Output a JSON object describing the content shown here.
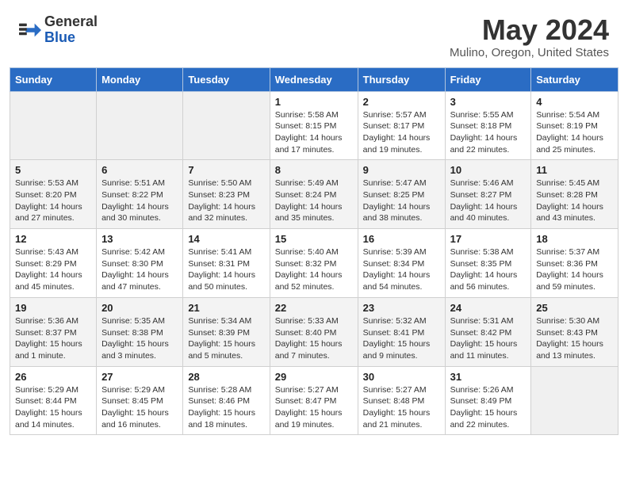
{
  "header": {
    "logo_general": "General",
    "logo_blue": "Blue",
    "month_year": "May 2024",
    "location": "Mulino, Oregon, United States"
  },
  "days_of_week": [
    "Sunday",
    "Monday",
    "Tuesday",
    "Wednesday",
    "Thursday",
    "Friday",
    "Saturday"
  ],
  "weeks": [
    [
      {
        "day": "",
        "info": ""
      },
      {
        "day": "",
        "info": ""
      },
      {
        "day": "",
        "info": ""
      },
      {
        "day": "1",
        "info": "Sunrise: 5:58 AM\nSunset: 8:15 PM\nDaylight: 14 hours and 17 minutes."
      },
      {
        "day": "2",
        "info": "Sunrise: 5:57 AM\nSunset: 8:17 PM\nDaylight: 14 hours and 19 minutes."
      },
      {
        "day": "3",
        "info": "Sunrise: 5:55 AM\nSunset: 8:18 PM\nDaylight: 14 hours and 22 minutes."
      },
      {
        "day": "4",
        "info": "Sunrise: 5:54 AM\nSunset: 8:19 PM\nDaylight: 14 hours and 25 minutes."
      }
    ],
    [
      {
        "day": "5",
        "info": "Sunrise: 5:53 AM\nSunset: 8:20 PM\nDaylight: 14 hours and 27 minutes."
      },
      {
        "day": "6",
        "info": "Sunrise: 5:51 AM\nSunset: 8:22 PM\nDaylight: 14 hours and 30 minutes."
      },
      {
        "day": "7",
        "info": "Sunrise: 5:50 AM\nSunset: 8:23 PM\nDaylight: 14 hours and 32 minutes."
      },
      {
        "day": "8",
        "info": "Sunrise: 5:49 AM\nSunset: 8:24 PM\nDaylight: 14 hours and 35 minutes."
      },
      {
        "day": "9",
        "info": "Sunrise: 5:47 AM\nSunset: 8:25 PM\nDaylight: 14 hours and 38 minutes."
      },
      {
        "day": "10",
        "info": "Sunrise: 5:46 AM\nSunset: 8:27 PM\nDaylight: 14 hours and 40 minutes."
      },
      {
        "day": "11",
        "info": "Sunrise: 5:45 AM\nSunset: 8:28 PM\nDaylight: 14 hours and 43 minutes."
      }
    ],
    [
      {
        "day": "12",
        "info": "Sunrise: 5:43 AM\nSunset: 8:29 PM\nDaylight: 14 hours and 45 minutes."
      },
      {
        "day": "13",
        "info": "Sunrise: 5:42 AM\nSunset: 8:30 PM\nDaylight: 14 hours and 47 minutes."
      },
      {
        "day": "14",
        "info": "Sunrise: 5:41 AM\nSunset: 8:31 PM\nDaylight: 14 hours and 50 minutes."
      },
      {
        "day": "15",
        "info": "Sunrise: 5:40 AM\nSunset: 8:32 PM\nDaylight: 14 hours and 52 minutes."
      },
      {
        "day": "16",
        "info": "Sunrise: 5:39 AM\nSunset: 8:34 PM\nDaylight: 14 hours and 54 minutes."
      },
      {
        "day": "17",
        "info": "Sunrise: 5:38 AM\nSunset: 8:35 PM\nDaylight: 14 hours and 56 minutes."
      },
      {
        "day": "18",
        "info": "Sunrise: 5:37 AM\nSunset: 8:36 PM\nDaylight: 14 hours and 59 minutes."
      }
    ],
    [
      {
        "day": "19",
        "info": "Sunrise: 5:36 AM\nSunset: 8:37 PM\nDaylight: 15 hours and 1 minute."
      },
      {
        "day": "20",
        "info": "Sunrise: 5:35 AM\nSunset: 8:38 PM\nDaylight: 15 hours and 3 minutes."
      },
      {
        "day": "21",
        "info": "Sunrise: 5:34 AM\nSunset: 8:39 PM\nDaylight: 15 hours and 5 minutes."
      },
      {
        "day": "22",
        "info": "Sunrise: 5:33 AM\nSunset: 8:40 PM\nDaylight: 15 hours and 7 minutes."
      },
      {
        "day": "23",
        "info": "Sunrise: 5:32 AM\nSunset: 8:41 PM\nDaylight: 15 hours and 9 minutes."
      },
      {
        "day": "24",
        "info": "Sunrise: 5:31 AM\nSunset: 8:42 PM\nDaylight: 15 hours and 11 minutes."
      },
      {
        "day": "25",
        "info": "Sunrise: 5:30 AM\nSunset: 8:43 PM\nDaylight: 15 hours and 13 minutes."
      }
    ],
    [
      {
        "day": "26",
        "info": "Sunrise: 5:29 AM\nSunset: 8:44 PM\nDaylight: 15 hours and 14 minutes."
      },
      {
        "day": "27",
        "info": "Sunrise: 5:29 AM\nSunset: 8:45 PM\nDaylight: 15 hours and 16 minutes."
      },
      {
        "day": "28",
        "info": "Sunrise: 5:28 AM\nSunset: 8:46 PM\nDaylight: 15 hours and 18 minutes."
      },
      {
        "day": "29",
        "info": "Sunrise: 5:27 AM\nSunset: 8:47 PM\nDaylight: 15 hours and 19 minutes."
      },
      {
        "day": "30",
        "info": "Sunrise: 5:27 AM\nSunset: 8:48 PM\nDaylight: 15 hours and 21 minutes."
      },
      {
        "day": "31",
        "info": "Sunrise: 5:26 AM\nSunset: 8:49 PM\nDaylight: 15 hours and 22 minutes."
      },
      {
        "day": "",
        "info": ""
      }
    ]
  ]
}
